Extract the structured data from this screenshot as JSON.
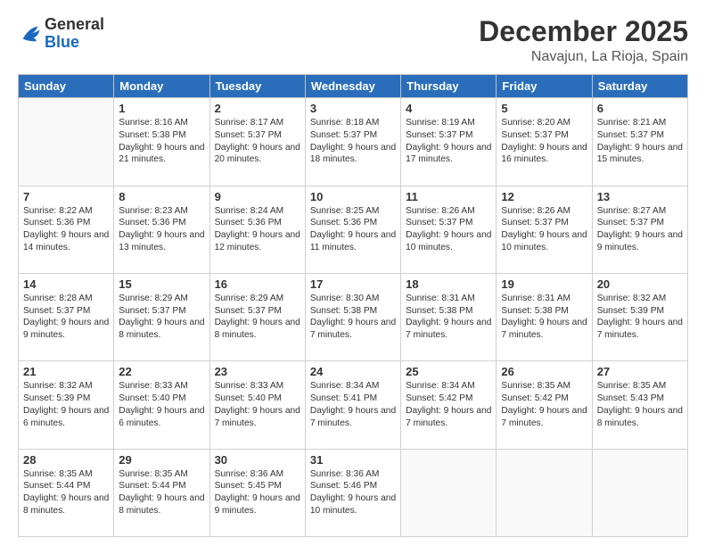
{
  "header": {
    "logo_general": "General",
    "logo_blue": "Blue",
    "month_title": "December 2025",
    "location": "Navajun, La Rioja, Spain"
  },
  "days_of_week": [
    "Sunday",
    "Monday",
    "Tuesday",
    "Wednesday",
    "Thursday",
    "Friday",
    "Saturday"
  ],
  "weeks": [
    [
      {
        "day": "",
        "info": ""
      },
      {
        "day": "1",
        "info": "Sunrise: 8:16 AM\nSunset: 5:38 PM\nDaylight: 9 hours\nand 21 minutes."
      },
      {
        "day": "2",
        "info": "Sunrise: 8:17 AM\nSunset: 5:37 PM\nDaylight: 9 hours\nand 20 minutes."
      },
      {
        "day": "3",
        "info": "Sunrise: 8:18 AM\nSunset: 5:37 PM\nDaylight: 9 hours\nand 18 minutes."
      },
      {
        "day": "4",
        "info": "Sunrise: 8:19 AM\nSunset: 5:37 PM\nDaylight: 9 hours\nand 17 minutes."
      },
      {
        "day": "5",
        "info": "Sunrise: 8:20 AM\nSunset: 5:37 PM\nDaylight: 9 hours\nand 16 minutes."
      },
      {
        "day": "6",
        "info": "Sunrise: 8:21 AM\nSunset: 5:37 PM\nDaylight: 9 hours\nand 15 minutes."
      }
    ],
    [
      {
        "day": "7",
        "info": "Sunrise: 8:22 AM\nSunset: 5:36 PM\nDaylight: 9 hours\nand 14 minutes."
      },
      {
        "day": "8",
        "info": "Sunrise: 8:23 AM\nSunset: 5:36 PM\nDaylight: 9 hours\nand 13 minutes."
      },
      {
        "day": "9",
        "info": "Sunrise: 8:24 AM\nSunset: 5:36 PM\nDaylight: 9 hours\nand 12 minutes."
      },
      {
        "day": "10",
        "info": "Sunrise: 8:25 AM\nSunset: 5:36 PM\nDaylight: 9 hours\nand 11 minutes."
      },
      {
        "day": "11",
        "info": "Sunrise: 8:26 AM\nSunset: 5:37 PM\nDaylight: 9 hours\nand 10 minutes."
      },
      {
        "day": "12",
        "info": "Sunrise: 8:26 AM\nSunset: 5:37 PM\nDaylight: 9 hours\nand 10 minutes."
      },
      {
        "day": "13",
        "info": "Sunrise: 8:27 AM\nSunset: 5:37 PM\nDaylight: 9 hours\nand 9 minutes."
      }
    ],
    [
      {
        "day": "14",
        "info": "Sunrise: 8:28 AM\nSunset: 5:37 PM\nDaylight: 9 hours\nand 9 minutes."
      },
      {
        "day": "15",
        "info": "Sunrise: 8:29 AM\nSunset: 5:37 PM\nDaylight: 9 hours\nand 8 minutes."
      },
      {
        "day": "16",
        "info": "Sunrise: 8:29 AM\nSunset: 5:37 PM\nDaylight: 9 hours\nand 8 minutes."
      },
      {
        "day": "17",
        "info": "Sunrise: 8:30 AM\nSunset: 5:38 PM\nDaylight: 9 hours\nand 7 minutes."
      },
      {
        "day": "18",
        "info": "Sunrise: 8:31 AM\nSunset: 5:38 PM\nDaylight: 9 hours\nand 7 minutes."
      },
      {
        "day": "19",
        "info": "Sunrise: 8:31 AM\nSunset: 5:38 PM\nDaylight: 9 hours\nand 7 minutes."
      },
      {
        "day": "20",
        "info": "Sunrise: 8:32 AM\nSunset: 5:39 PM\nDaylight: 9 hours\nand 7 minutes."
      }
    ],
    [
      {
        "day": "21",
        "info": "Sunrise: 8:32 AM\nSunset: 5:39 PM\nDaylight: 9 hours\nand 6 minutes."
      },
      {
        "day": "22",
        "info": "Sunrise: 8:33 AM\nSunset: 5:40 PM\nDaylight: 9 hours\nand 6 minutes."
      },
      {
        "day": "23",
        "info": "Sunrise: 8:33 AM\nSunset: 5:40 PM\nDaylight: 9 hours\nand 7 minutes."
      },
      {
        "day": "24",
        "info": "Sunrise: 8:34 AM\nSunset: 5:41 PM\nDaylight: 9 hours\nand 7 minutes."
      },
      {
        "day": "25",
        "info": "Sunrise: 8:34 AM\nSunset: 5:42 PM\nDaylight: 9 hours\nand 7 minutes."
      },
      {
        "day": "26",
        "info": "Sunrise: 8:35 AM\nSunset: 5:42 PM\nDaylight: 9 hours\nand 7 minutes."
      },
      {
        "day": "27",
        "info": "Sunrise: 8:35 AM\nSunset: 5:43 PM\nDaylight: 9 hours\nand 8 minutes."
      }
    ],
    [
      {
        "day": "28",
        "info": "Sunrise: 8:35 AM\nSunset: 5:44 PM\nDaylight: 9 hours\nand 8 minutes."
      },
      {
        "day": "29",
        "info": "Sunrise: 8:35 AM\nSunset: 5:44 PM\nDaylight: 9 hours\nand 8 minutes."
      },
      {
        "day": "30",
        "info": "Sunrise: 8:36 AM\nSunset: 5:45 PM\nDaylight: 9 hours\nand 9 minutes."
      },
      {
        "day": "31",
        "info": "Sunrise: 8:36 AM\nSunset: 5:46 PM\nDaylight: 9 hours\nand 10 minutes."
      },
      {
        "day": "",
        "info": ""
      },
      {
        "day": "",
        "info": ""
      },
      {
        "day": "",
        "info": ""
      }
    ]
  ]
}
